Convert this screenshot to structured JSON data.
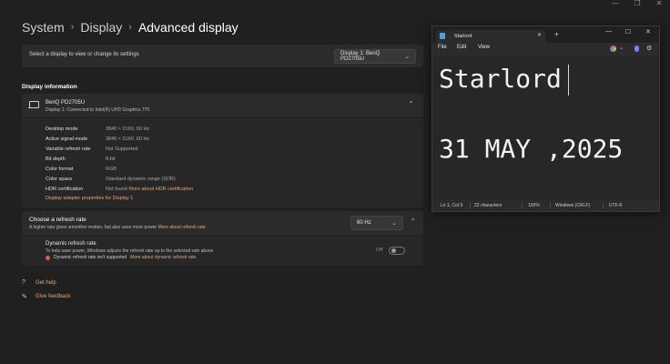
{
  "window_controls": {
    "minimize": "—",
    "restore": "❐",
    "close": "✕"
  },
  "breadcrumb": {
    "level1": "System",
    "level2": "Display",
    "current": "Advanced display",
    "separator": "›"
  },
  "display_selector": {
    "label": "Select a display to view or change its settings",
    "value": "Display 1: BenQ PD2705U"
  },
  "display_information": {
    "section_title": "Display information",
    "monitor_name": "BenQ PD2705U",
    "monitor_subtitle": "Display 1: Connected to Intel(R) UHD Graphics 770",
    "rows": [
      {
        "label": "Desktop mode",
        "value": "3840 × 2160, 60 Hz"
      },
      {
        "label": "Active signal mode",
        "value": "3840 × 2160, 60 Hz"
      },
      {
        "label": "Variable refresh rate",
        "value": "Not Supported"
      },
      {
        "label": "Bit depth",
        "value": "8-bit"
      },
      {
        "label": "Color format",
        "value": "RGB"
      },
      {
        "label": "Color space",
        "value": "Standard dynamic range (SDR)"
      },
      {
        "label": "HDR certification",
        "value": "Not found",
        "link": "More about HDR certification"
      }
    ],
    "adapter_link": "Display adapter properties for Display 1"
  },
  "refresh_rate": {
    "title": "Choose a refresh rate",
    "subtitle": "A higher rate gives smoother motion, but also uses more power",
    "link": "More about refresh rate",
    "value": "60 Hz"
  },
  "dynamic_refresh": {
    "title": "Dynamic refresh rate",
    "subtitle": "To help save power, Windows adjusts the refresh rate up to the selected rate above",
    "warning": "Dynamic refresh rate isn't supported",
    "warning_link": "More about dynamic refresh rate",
    "toggle_label": "Off",
    "toggle_on": false
  },
  "help_links": {
    "get_help": "Get help",
    "give_feedback": "Give feedback"
  },
  "notepad": {
    "tab_title": "Starlord",
    "tab_close": "✕",
    "new_tab": "+",
    "controls": {
      "minimize": "—",
      "maximize": "☐",
      "close": "✕"
    },
    "menu": {
      "file": "File",
      "edit": "Edit",
      "view": "View"
    },
    "content_line1": "Starlord",
    "content_line2": "31 MAY ,2025",
    "status": {
      "position": "Ln 1, Col 9",
      "characters": "22 characters",
      "zoom": "100%",
      "line_ending": "Windows (CRLF)",
      "encoding": "UTF-8"
    }
  },
  "icons": {
    "chevron_right": "›",
    "chevron_down": "⌄",
    "chevron_up": "⌃",
    "help": "?",
    "feedback": "✎",
    "gear": "⚙"
  },
  "colors": {
    "accent_link": "#e3a77b",
    "background": "#202020",
    "card": "#2b2b2b",
    "warning": "#e35b4f"
  }
}
